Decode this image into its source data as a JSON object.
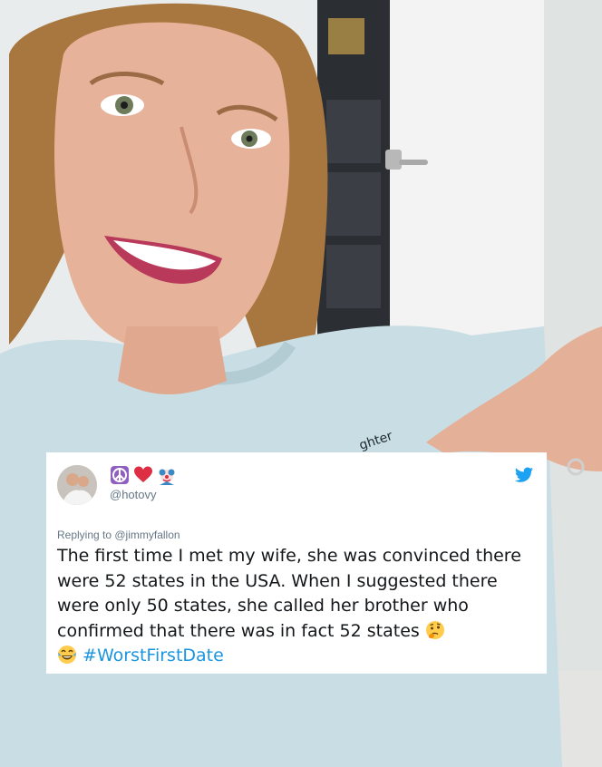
{
  "tweet": {
    "handle": "@hotovy",
    "emojis": [
      "peace-symbol-emoji",
      "red-heart-emoji",
      "clown-emoji"
    ],
    "replying_to": "Replying to @jimmyfallon",
    "text": "The first time I met my wife, she was convinced there were 52 states in the USA. When I suggested there were only 50 states, she called her brother who confirmed that there was in fact 52 states",
    "trailing_emoji": "thinking-face-emoji",
    "leading_emoji": "tears-of-joy-emoji",
    "hashtag": "#WorstFirstDate",
    "accent_color": "#1b95e0",
    "text_color": "#14171a",
    "muted_color": "#657786"
  },
  "photo": {
    "subject": "smiling woman selfie pointing at tweet",
    "sweatshirt_text": "ghter"
  }
}
